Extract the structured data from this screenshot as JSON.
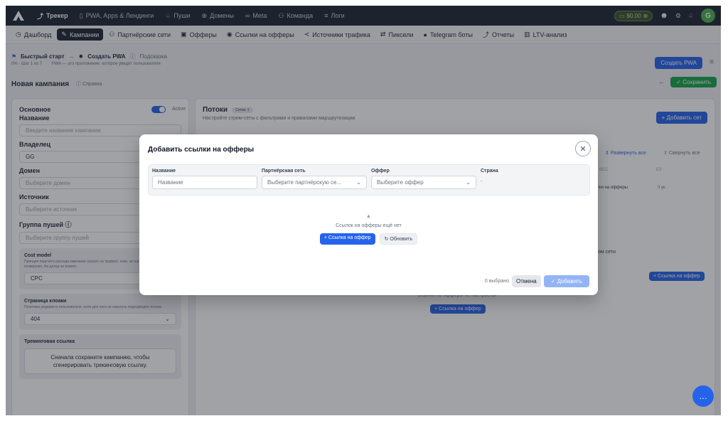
{
  "topnav": {
    "items": [
      {
        "icon": "chart-line-icon",
        "label": "Трекер"
      },
      {
        "icon": "phone-icon",
        "label": "PWA, Apps & Лендинги"
      },
      {
        "icon": "bell-icon",
        "label": "Пуши"
      },
      {
        "icon": "globe-icon",
        "label": "Домены"
      },
      {
        "icon": "infinity-icon",
        "label": "Meta"
      },
      {
        "icon": "users-icon",
        "label": "Команда"
      },
      {
        "icon": "list-icon",
        "label": "Логи"
      }
    ],
    "balance": "$0.00",
    "avatar_letter": "G"
  },
  "subnav": {
    "items": [
      {
        "icon": "clock-icon",
        "label": "Дашборд"
      },
      {
        "icon": "edit-icon",
        "label": "Кампании"
      },
      {
        "icon": "users-icon",
        "label": "Партнёрские сети"
      },
      {
        "icon": "gift-icon",
        "label": "Офферы"
      },
      {
        "icon": "pin-icon",
        "label": "Ссылки на офферы"
      },
      {
        "icon": "share-icon",
        "label": "Источники трафика"
      },
      {
        "icon": "arrows-icon",
        "label": "Пиксели"
      },
      {
        "icon": "telegram-icon",
        "label": "Telegram боты"
      },
      {
        "icon": "chart-line-icon",
        "label": "Отчеты"
      },
      {
        "icon": "bar-chart-icon",
        "label": "LTV-анализ"
      }
    ]
  },
  "breadcrumb": {
    "quick_start": "Быстрый старт",
    "step": "Создать PWA",
    "hint": "Подсказка",
    "progress": "0%",
    "step_count": "Шаг 1 из 7",
    "hint_text": "PWA — это приложение, которое увидят пользователи",
    "create_pwa": "Создать PWA"
  },
  "page": {
    "title": "Новая кампания",
    "help": "Справка",
    "save": "Сохранить"
  },
  "left": {
    "section": "Основное",
    "active_label": "Active",
    "name_label": "Название",
    "name_placeholder": "Введите название кампании",
    "owner_label": "Владелец",
    "owner_value": "GG",
    "domain_label": "Домен",
    "domain_placeholder": "Выберите домен",
    "source_label": "Источник",
    "source_placeholder": "Выберите источник",
    "push_label": "Группа пушей",
    "push_placeholder": "Выберите группу пушей",
    "cost_title": "Cost model",
    "cost_desc": "Принцип подсчёта расхода кампании (затрат на трафик): клик, за тысячу показов или за конверсию. На доход не влияет.",
    "cost_value": "CPC",
    "cloak_title": "Страница клоаки",
    "cloak_desc": "Политика редиректа пользователя, если для него не нашлось подходящего потока",
    "cloak_value": "404",
    "tracking_title": "Трекинговая ссылка",
    "tracking_note": "Сначала сохраните кампанию, чтобы сгенерировать трекинговую ссылку."
  },
  "right": {
    "title": "Потоки",
    "chip": "Сетов: 1",
    "subtitle": "Настройте стрим-сеты с фильтрами и правилами маршрутизации",
    "add_set": "+ Добавить сет",
    "expand_all": "Развернуть все",
    "collapse_all": "Свернуть все",
    "col1": "ВЕС",
    "col2": "ЕЗ",
    "row_link": "ылки на офферы",
    "row_value": "0 ук",
    "network_text": "ом сети",
    "offer_link_btn": "+ Ссылка на оффер",
    "not_configured": "Ссылки на офферы не настроены",
    "offer_link_btn2": "+ Ссылка на оффер"
  },
  "modal": {
    "title": "Добавить ссылки на офферы",
    "filters": {
      "name_label": "Название",
      "name_placeholder": "Название",
      "network_label": "Партнёрская сеть",
      "network_placeholder": "Выберите партнёрскую се...",
      "offer_label": "Оффер",
      "offer_placeholder": "Выберите оффер",
      "country_label": "Страна",
      "country_value": "-"
    },
    "empty_text": "Ссылок на офферы ещё нет",
    "add_link": "+ Ссылка на оффер",
    "refresh": "Обновить",
    "selected": "0 выбрано",
    "cancel": "Отмена",
    "add": "Добавить"
  }
}
